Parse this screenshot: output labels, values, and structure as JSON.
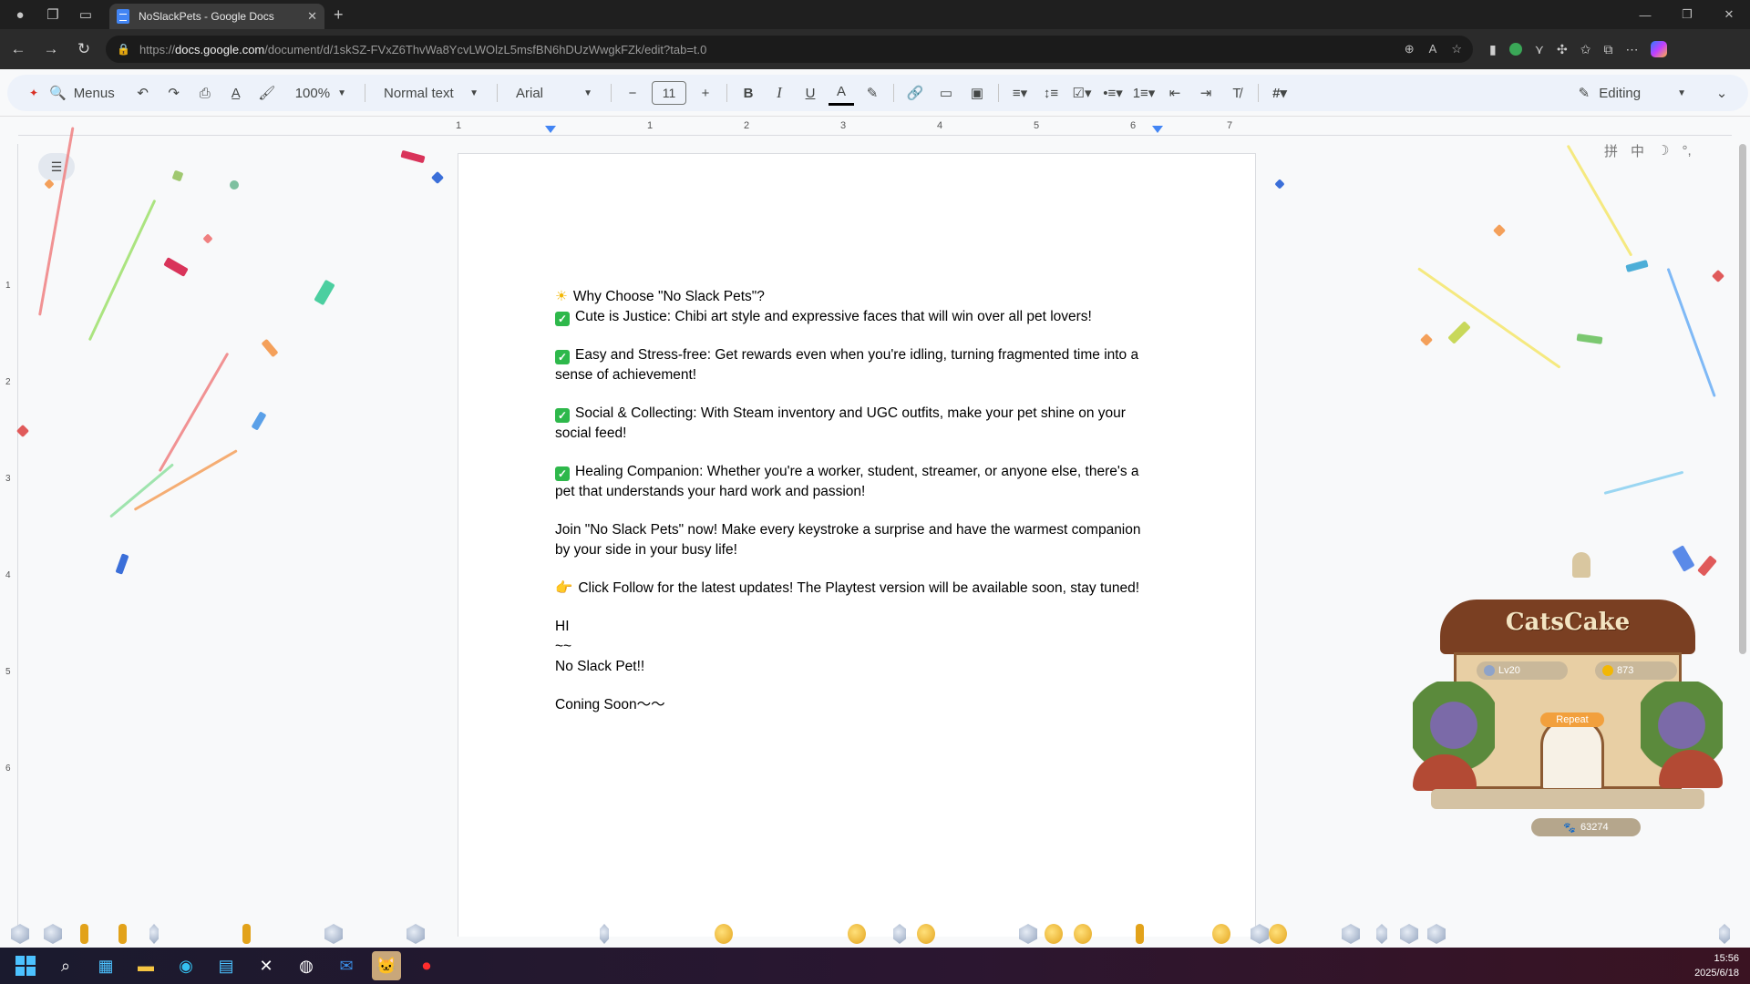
{
  "browser": {
    "tab_title": "NoSlackPets - Google Docs",
    "url_host": "docs.google.com",
    "url_scheme": "https://",
    "url_path": "/document/d/1skSZ-FVxZ6ThvWa8YcvLWOlzL5msfBN6hDUzWwgkFZk/edit?tab=t.0",
    "new_tab_glyph": "+",
    "close_glyph": "✕"
  },
  "toolbar": {
    "menus_label": "Menus",
    "zoom": "100%",
    "style": "Normal text",
    "font": "Arial",
    "font_size": "11",
    "editing_label": "Editing"
  },
  "ruler": {
    "h_ticks": [
      "1",
      "1",
      "2",
      "3",
      "4",
      "5",
      "6",
      "7"
    ],
    "v_ticks": [
      "1",
      "2",
      "3",
      "4",
      "5",
      "6"
    ]
  },
  "document": {
    "heading": "Why Choose \"No Slack Pets\"?",
    "points": [
      "Cute is Justice: Chibi art style and expressive faces that will win over all pet lovers!",
      "Easy and Stress-free: Get rewards even when you're idling, turning fragmented time into a sense of achievement!",
      "Social & Collecting: With Steam inventory and UGC outfits, make your pet shine on your social feed!",
      "Healing Companion: Whether you're a worker, student, streamer, or anyone else, there's a pet that understands your hard work and passion!"
    ],
    "join": "Join \"No Slack Pets\" now! Make every keystroke a surprise and have the warmest companion by your side in your busy life!",
    "follow": "Click Follow for the latest updates! The Playtest version will be available soon, stay tuned!",
    "hi": "HI",
    "tilde": "~~",
    "sign": "No Slack Pet!!",
    "coming": "Coning Soon〜〜"
  },
  "pet_widget": {
    "shop_name": "CatsCake",
    "level": "Lv20",
    "coins": "873",
    "repeat_label": "Repeat",
    "keystrokes": "63274"
  },
  "ime": {
    "mode": "中"
  },
  "taskbar": {
    "time": "15:56",
    "date": "2025/6/18"
  },
  "colors": {
    "accent": "#4285f4",
    "check_green": "#2eb84b",
    "toolbar_bg": "#edf2fa"
  }
}
